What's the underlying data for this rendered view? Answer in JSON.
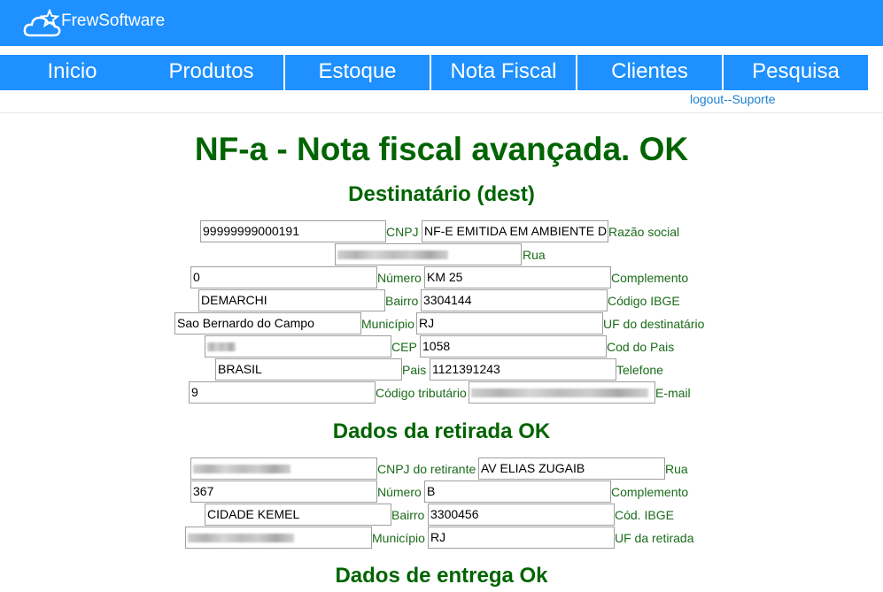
{
  "header": {
    "brand": "FrewSoftware",
    "logo_icon": "cloud-star-icon"
  },
  "nav": {
    "items": [
      "Inicio",
      "Produtos",
      "Estoque",
      "Nota Fiscal",
      "Clientes",
      "Pesquisa"
    ]
  },
  "links": {
    "logout": "logout--Suporte"
  },
  "page": {
    "title": "NF-a - Nota fiscal avançada. OK"
  },
  "dest": {
    "heading": "Destinatário (dest)",
    "cnpj_value": "99999999000191",
    "cnpj_label": "CNPJ",
    "razao_value": "NF-E EMITIDA EM AMBIENTE DE HOMOLOGACAO",
    "razao_label": "Razão social",
    "rua_label": "Rua",
    "numero_value": "0",
    "numero_label": "Número",
    "complemento_value": "KM 25",
    "complemento_label": "Complemento",
    "bairro_value": "DEMARCHI",
    "bairro_label": "Bairro",
    "ibge_value": "3304144",
    "ibge_label": "Código IBGE",
    "municipio_value": "Sao Bernardo do Campo",
    "municipio_label": "Município",
    "uf_value": "RJ",
    "uf_label": "UF do destinatário",
    "cep_label": "CEP",
    "codpais_value": "1058",
    "codpais_label": "Cod do Pais",
    "pais_value": "BRASIL",
    "pais_label": "Pais",
    "telefone_value": "1121391243",
    "telefone_label": "Telefone",
    "codtrib_value": "9",
    "codtrib_label": "Código tributário",
    "email_label": "E-mail"
  },
  "retirada": {
    "heading": "Dados da retirada OK",
    "cnpj_label": "CNPJ do retirante",
    "rua_value": "AV ELIAS ZUGAIB",
    "rua_label": "Rua",
    "numero_value": "367",
    "numero_label": "Número",
    "complemento_value": "B",
    "complemento_label": "Complemento",
    "bairro_value": "CIDADE KEMEL",
    "bairro_label": "Bairro",
    "ibge_value": "3300456",
    "ibge_label": "Cód. IBGE",
    "municipio_label": "Município",
    "uf_value": "RJ",
    "uf_label": "UF da retirada"
  },
  "entrega": {
    "heading": "Dados de entrega Ok"
  }
}
